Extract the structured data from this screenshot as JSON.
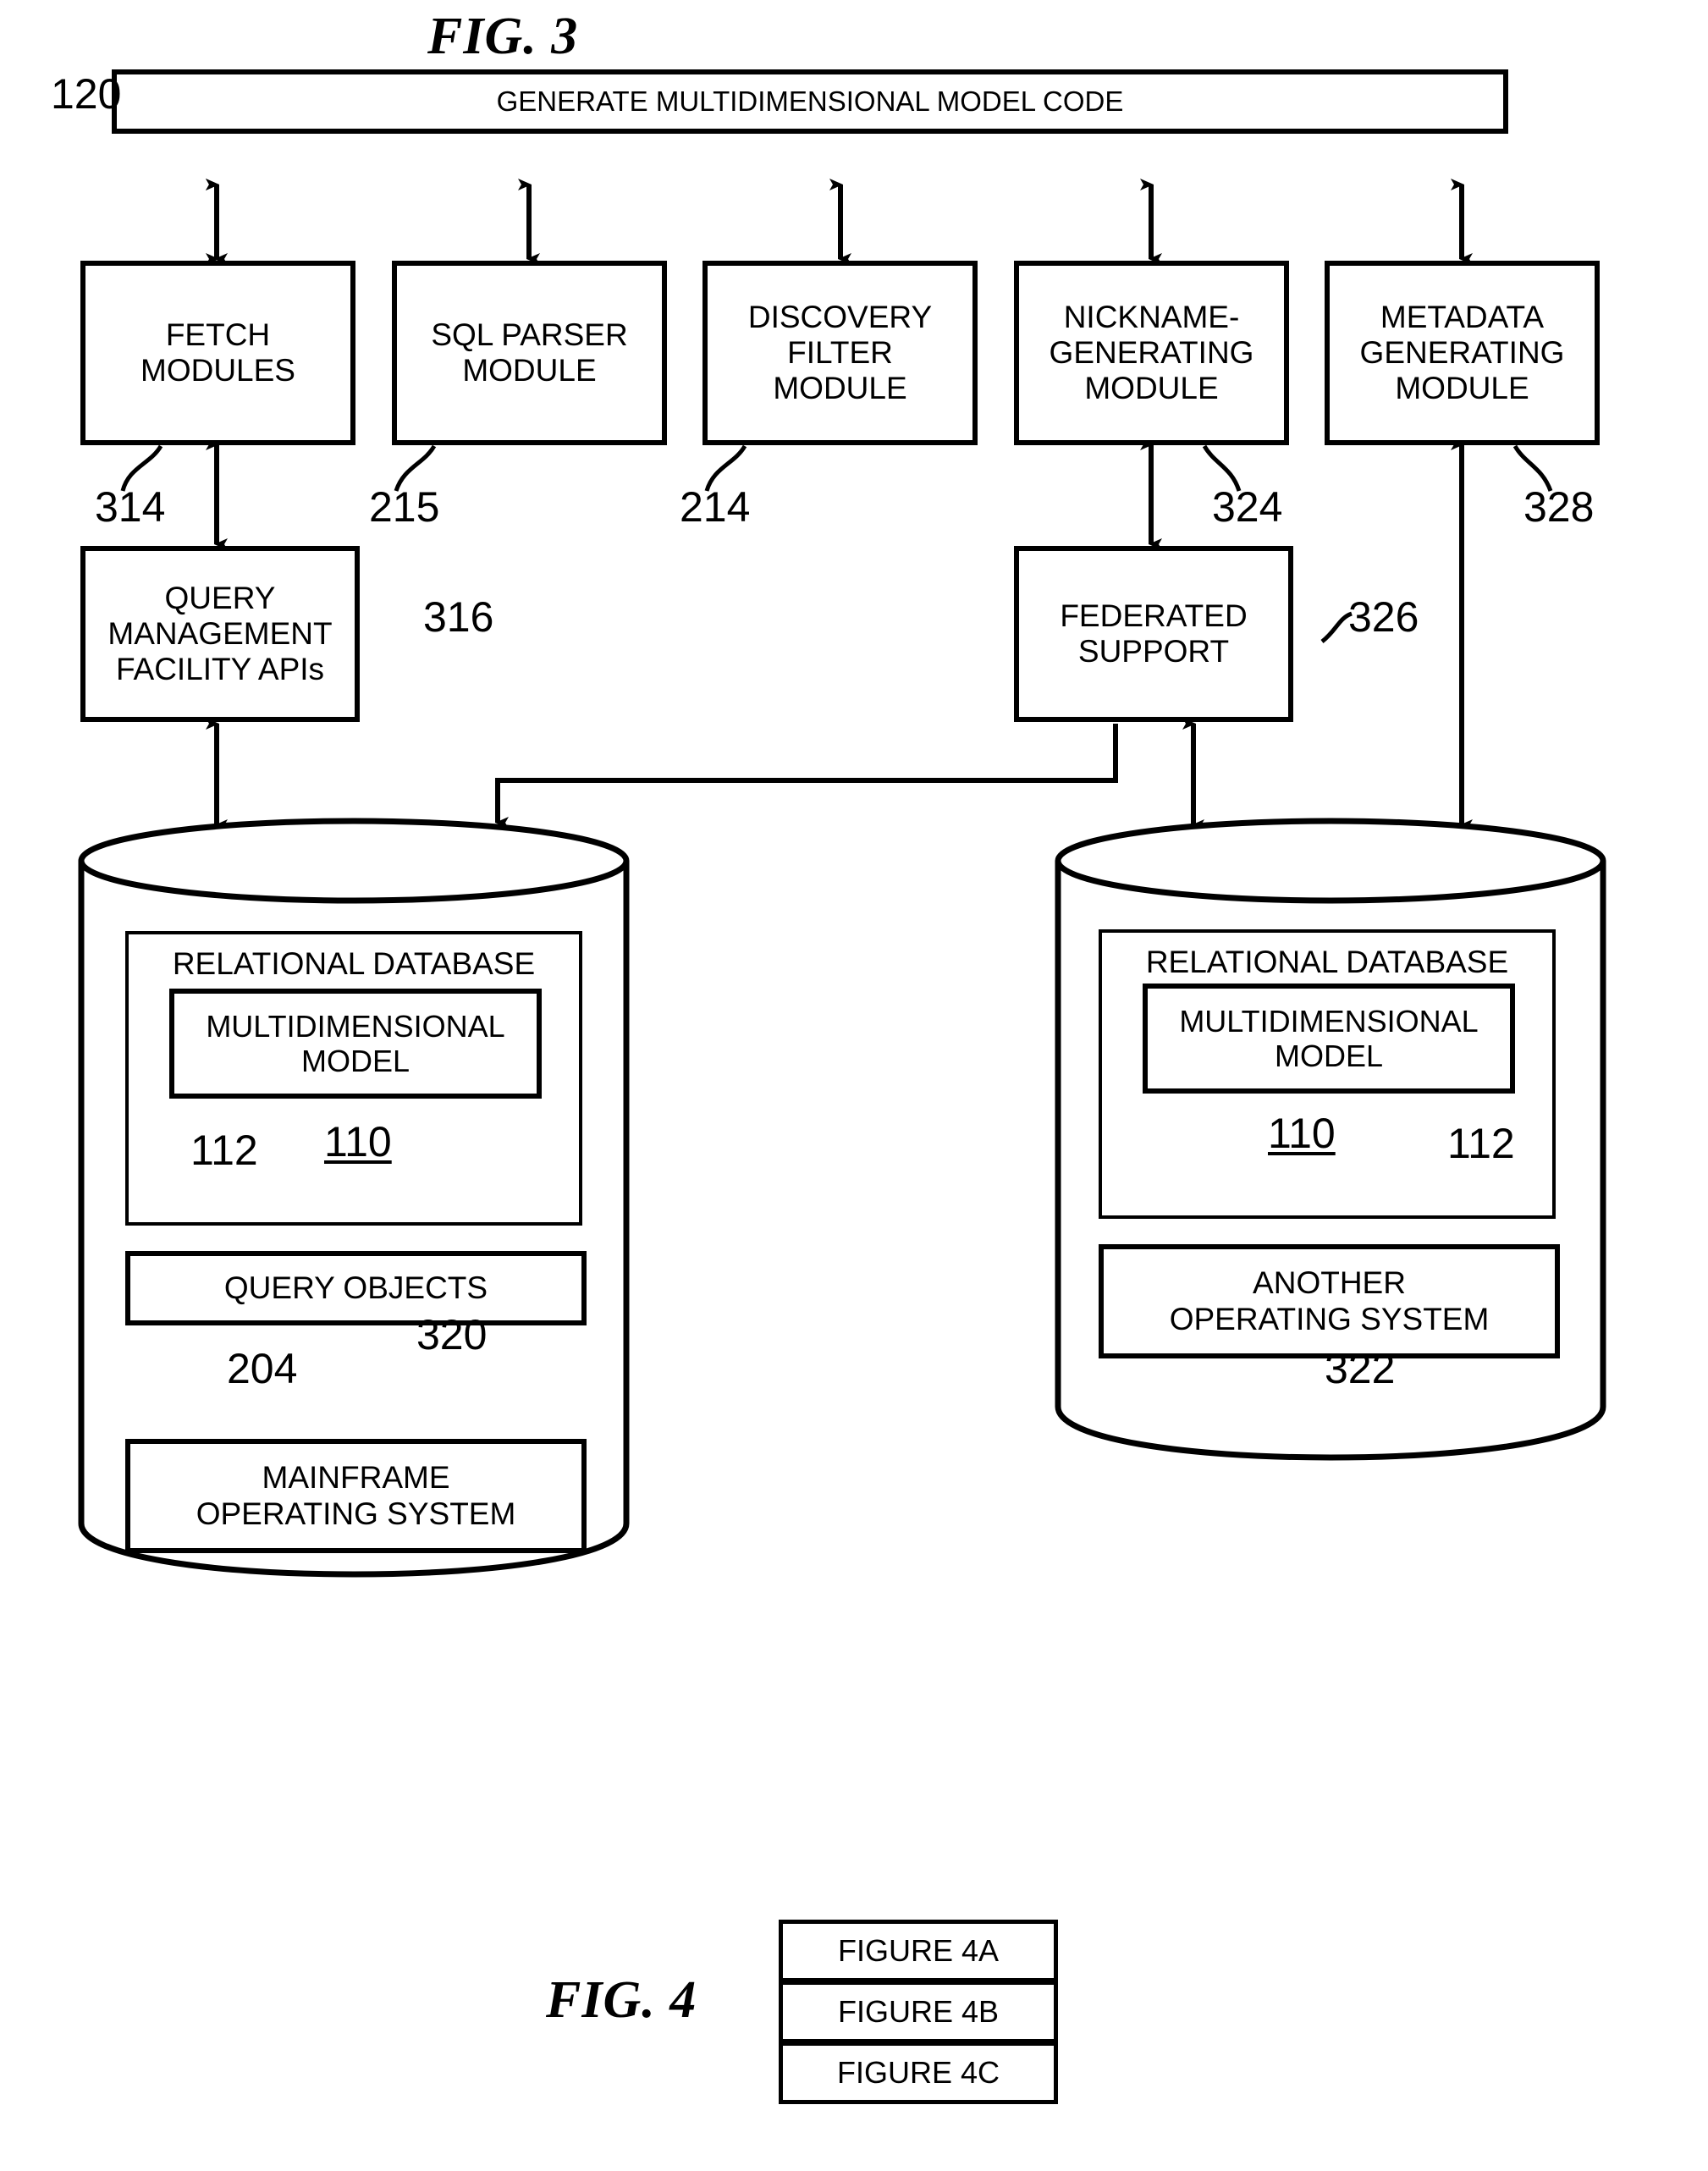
{
  "figures": {
    "fig3_title": "FIG. 3",
    "fig4_title": "FIG. 4"
  },
  "fig3": {
    "top_box": {
      "label": "GENERATE MULTIDIMENSIONAL MODEL CODE",
      "ref": "120"
    },
    "modules": [
      {
        "label": "FETCH\nMODULES",
        "ref": "314"
      },
      {
        "label": "SQL PARSER\nMODULE",
        "ref": "215"
      },
      {
        "label": "DISCOVERY\nFILTER\nMODULE",
        "ref": "214"
      },
      {
        "label": "NICKNAME-\nGENERATING\nMODULE",
        "ref": "324"
      },
      {
        "label": "METADATA\nGENERATING\nMODULE",
        "ref": "328"
      }
    ],
    "mid_boxes": [
      {
        "label": "QUERY\nMANAGEMENT\nFACILITY APIs",
        "ref": "316"
      },
      {
        "label": "FEDERATED\nSUPPORT",
        "ref": "326"
      }
    ],
    "left_cylinder": {
      "relational_database": {
        "label": "RELATIONAL DATABASE",
        "ref": "110"
      },
      "multidimensional_model": {
        "label": "MULTIDIMENSIONAL\nMODEL",
        "ref": "112"
      },
      "query_objects": {
        "label": "QUERY OBJECTS",
        "ref": "204"
      },
      "operating_system": {
        "label": "MAINFRAME\nOPERATING SYSTEM",
        "ref": "320"
      }
    },
    "right_cylinder": {
      "relational_database": {
        "label": "RELATIONAL DATABASE",
        "ref": "110"
      },
      "multidimensional_model": {
        "label": "MULTIDIMENSIONAL\nMODEL",
        "ref": "112"
      },
      "operating_system": {
        "label": "ANOTHER\nOPERATING SYSTEM",
        "ref": "322"
      }
    }
  },
  "fig4": {
    "rows": [
      {
        "label": "FIGURE 4A"
      },
      {
        "label": "FIGURE 4B"
      },
      {
        "label": "FIGURE 4C"
      }
    ]
  },
  "colors": {
    "ink": "#000000",
    "paper": "#ffffff"
  }
}
